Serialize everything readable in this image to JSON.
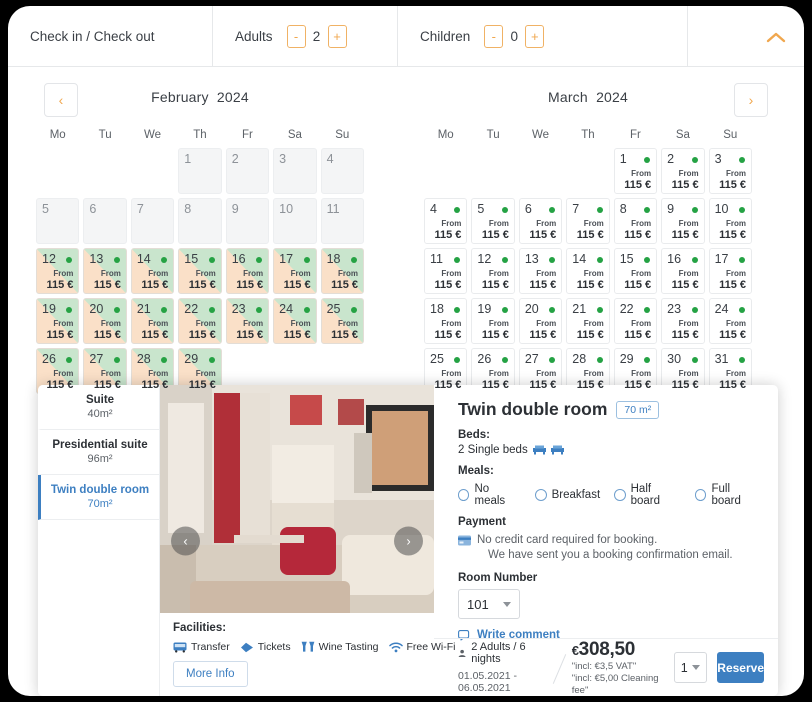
{
  "search_bar": {
    "checkdates_label": "Check in / Check out",
    "adults_label": "Adults",
    "adults_value": "2",
    "children_label": "Children",
    "children_value": "0",
    "minus_label": "-",
    "plus_label": "+",
    "collapse_icon": "chevron-up-icon"
  },
  "calendar": {
    "prev_label": "‹",
    "next_label": "›",
    "dow": [
      "Mo",
      "Tu",
      "We",
      "Th",
      "Fr",
      "Sa",
      "Su"
    ],
    "price_from": "From",
    "price_amount": "115 €",
    "months": [
      {
        "name": "February",
        "year": "2024",
        "lead_blanks": 3,
        "days": 29,
        "past_through": 11,
        "split_from": 12
      },
      {
        "name": "March",
        "year": "2024",
        "lead_blanks": 4,
        "days": 31,
        "past_through": 0,
        "split_from": 99
      }
    ]
  },
  "room_list": [
    {
      "name": "Suite",
      "size": "40m²",
      "active": false
    },
    {
      "name": "Presidential suite",
      "size": "96m²",
      "active": false
    },
    {
      "name": "Twin double room",
      "size": "70m²",
      "active": true
    }
  ],
  "gallery": {
    "prev_label": "‹",
    "next_label": "›"
  },
  "facilities": {
    "title": "Facilities:",
    "items": [
      {
        "icon": "bus-icon",
        "label": "Transfer"
      },
      {
        "icon": "ticket-icon",
        "label": "Tickets"
      },
      {
        "icon": "wine-glasses-icon",
        "label": "Wine Tasting"
      },
      {
        "icon": "wifi-icon",
        "label": "Free Wi-Fi"
      }
    ],
    "more_info_label": "More Info"
  },
  "detail": {
    "title": "Twin double room",
    "size_badge": "70 m²",
    "beds_label": "Beds:",
    "beds_value": "2 Single beds",
    "meals_label": "Meals:",
    "meals_options": [
      "No meals",
      "Breakfast",
      "Half board",
      "Full board"
    ],
    "payment_label": "Payment",
    "payment_line1": "No credit card required for booking.",
    "payment_line2": "We have sent you a booking confirmation email.",
    "room_number_label": "Room Number",
    "room_number_value": "101",
    "write_comment_label": "Write comment"
  },
  "footer": {
    "guests": "2 Adults / 6 nights",
    "dates": "01.05.2021 - 06.05.2021",
    "currency": "€",
    "price": "308,50",
    "vat_note": "\"incl: €3,5 VAT\"",
    "cleaning_note": "\"incl: €5,00 Cleaning fee\"",
    "quantity": "1",
    "reserve_label": "Reserve"
  },
  "colors": {
    "accent_orange": "#f0a74e",
    "accent_blue": "#3d7fc1",
    "available_green": "#25a244",
    "cell_peach": "#fae0c8",
    "cell_green": "#c9e5cd"
  }
}
